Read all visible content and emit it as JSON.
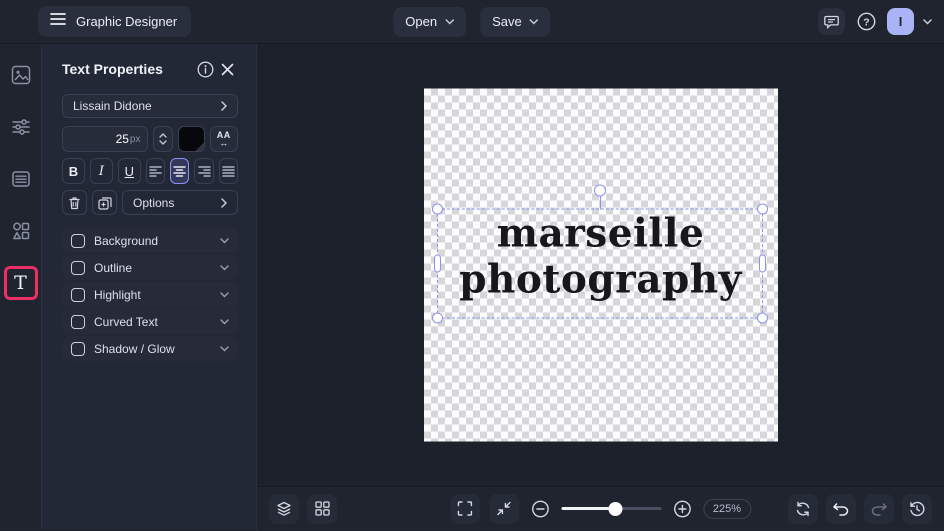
{
  "topbar": {
    "app_title": "Graphic Designer",
    "open_label": "Open",
    "save_label": "Save",
    "avatar_initial": "I"
  },
  "panel": {
    "title": "Text Properties",
    "font_name": "Lissain Didone",
    "font_size_value": "25",
    "font_size_unit": "px",
    "bold_label": "B",
    "italic_label": "I",
    "underline_label": "U",
    "letter_spacing_label": "AA",
    "letter_spacing_arrow": "↔",
    "options_label": "Options",
    "toggles": [
      {
        "label": "Background",
        "checked": false
      },
      {
        "label": "Outline",
        "checked": false
      },
      {
        "label": "Highlight",
        "checked": false
      },
      {
        "label": "Curved Text",
        "checked": false
      },
      {
        "label": "Shadow / Glow",
        "checked": false
      }
    ]
  },
  "canvas": {
    "text_line1": "marseille",
    "text_line2": "photography",
    "text_color": "#17171c",
    "selection_color": "#8b93ec"
  },
  "bottom_toolbar": {
    "zoom_level": "225%"
  },
  "colors": {
    "accent_pink": "#ED2E67",
    "selected_purple": "#8a90f0",
    "avatar_bg": "#aab3f5",
    "panel_bg": "#232836",
    "topbar_bg": "#20242f"
  },
  "rail_item_t_label": "T"
}
